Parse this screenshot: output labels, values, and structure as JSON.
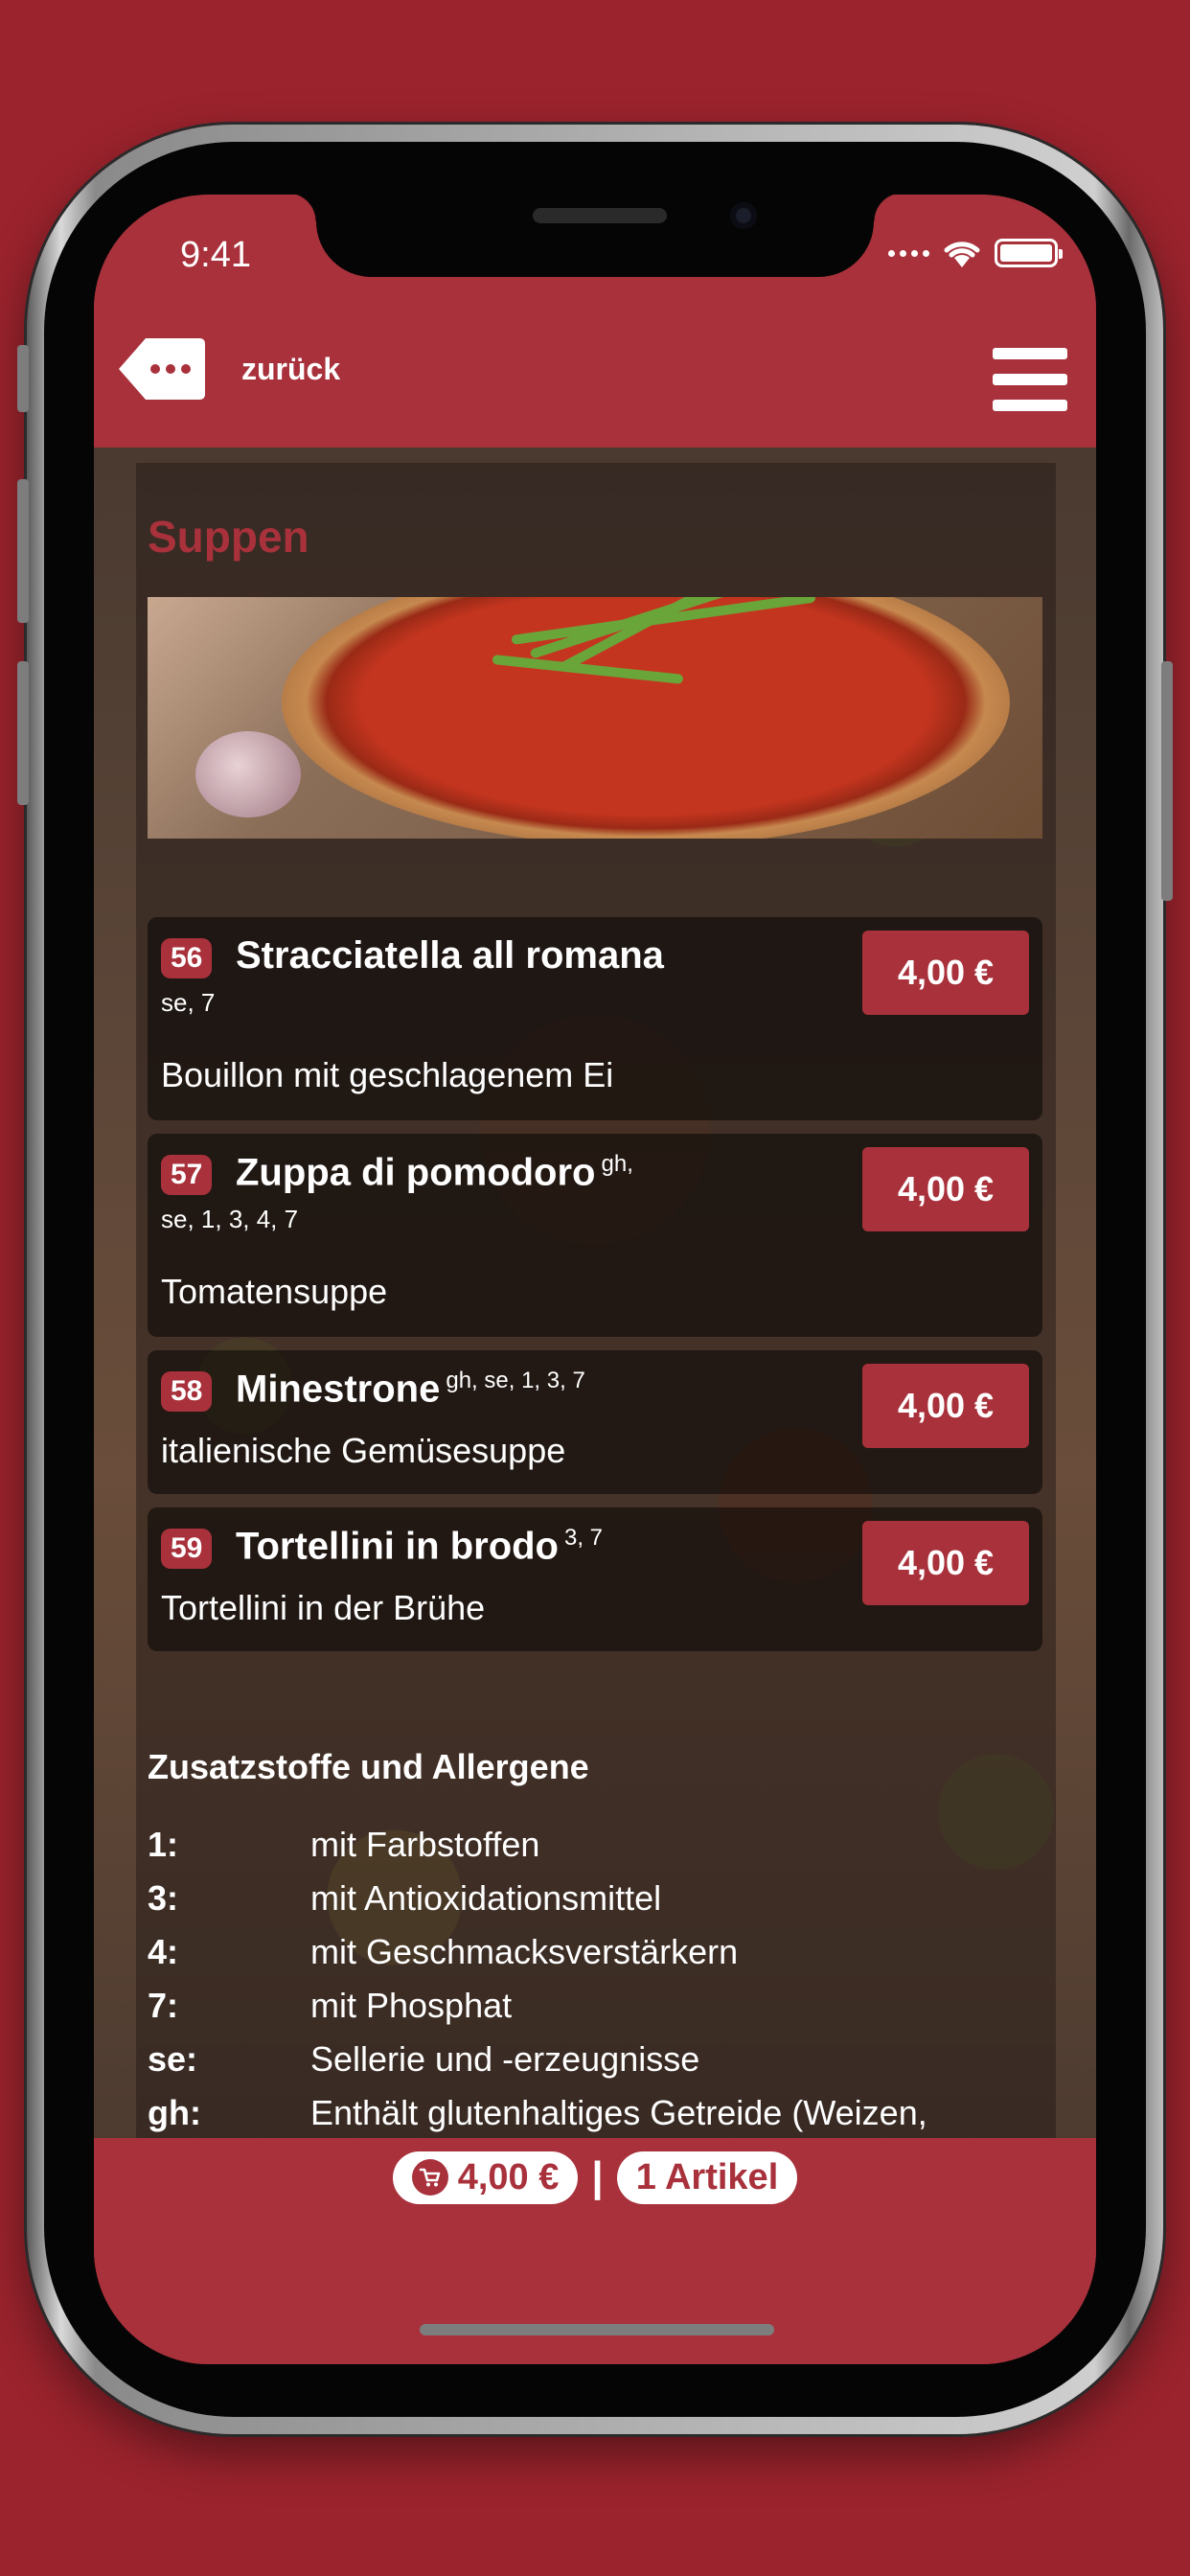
{
  "status_bar": {
    "time": "9:41"
  },
  "header": {
    "back_label": "zurück"
  },
  "section": {
    "title": "Suppen"
  },
  "items": [
    {
      "number": "56",
      "name": "Stracciatella all romana",
      "sup": "",
      "allergens": "se, 7",
      "description": "Bouillon mit geschlagenem Ei",
      "price": "4,00 €"
    },
    {
      "number": "57",
      "name": "Zuppa di pomodoro",
      "sup": "gh,",
      "allergens": "se, 1, 3, 4, 7",
      "description": "Tomatensuppe",
      "price": "4,00 €"
    },
    {
      "number": "58",
      "name": "Minestrone",
      "sup": "gh, se, 1, 3, 7",
      "allergens": "",
      "description": "italienische Gemüsesuppe",
      "price": "4,00 €"
    },
    {
      "number": "59",
      "name": "Tortellini in brodo",
      "sup": "3, 7",
      "allergens": "",
      "description": "Tortellini in der Brühe",
      "price": "4,00 €"
    }
  ],
  "legend": {
    "title": "Zusatzstoffe und Allergene",
    "rows": [
      {
        "code": "1:",
        "text": "mit Farbstoffen"
      },
      {
        "code": "3:",
        "text": "mit Antioxidationsmittel"
      },
      {
        "code": "4:",
        "text": "mit Geschmacksverstärkern"
      },
      {
        "code": "7:",
        "text": "mit Phosphat"
      },
      {
        "code": "se:",
        "text": "Sellerie und -erzeugnisse"
      },
      {
        "code": "gh:",
        "text": "Enthält glutenhaltiges Getreide (Weizen,"
      }
    ]
  },
  "footer": {
    "cart_total": "4,00 €",
    "separator": "|",
    "item_count": "1 Artikel"
  },
  "colors": {
    "brand": "#a8313b",
    "background": "#9b232d"
  },
  "icons": {
    "back": "more-dots-tag-icon",
    "menu": "hamburger-icon",
    "cart": "cart-icon"
  }
}
